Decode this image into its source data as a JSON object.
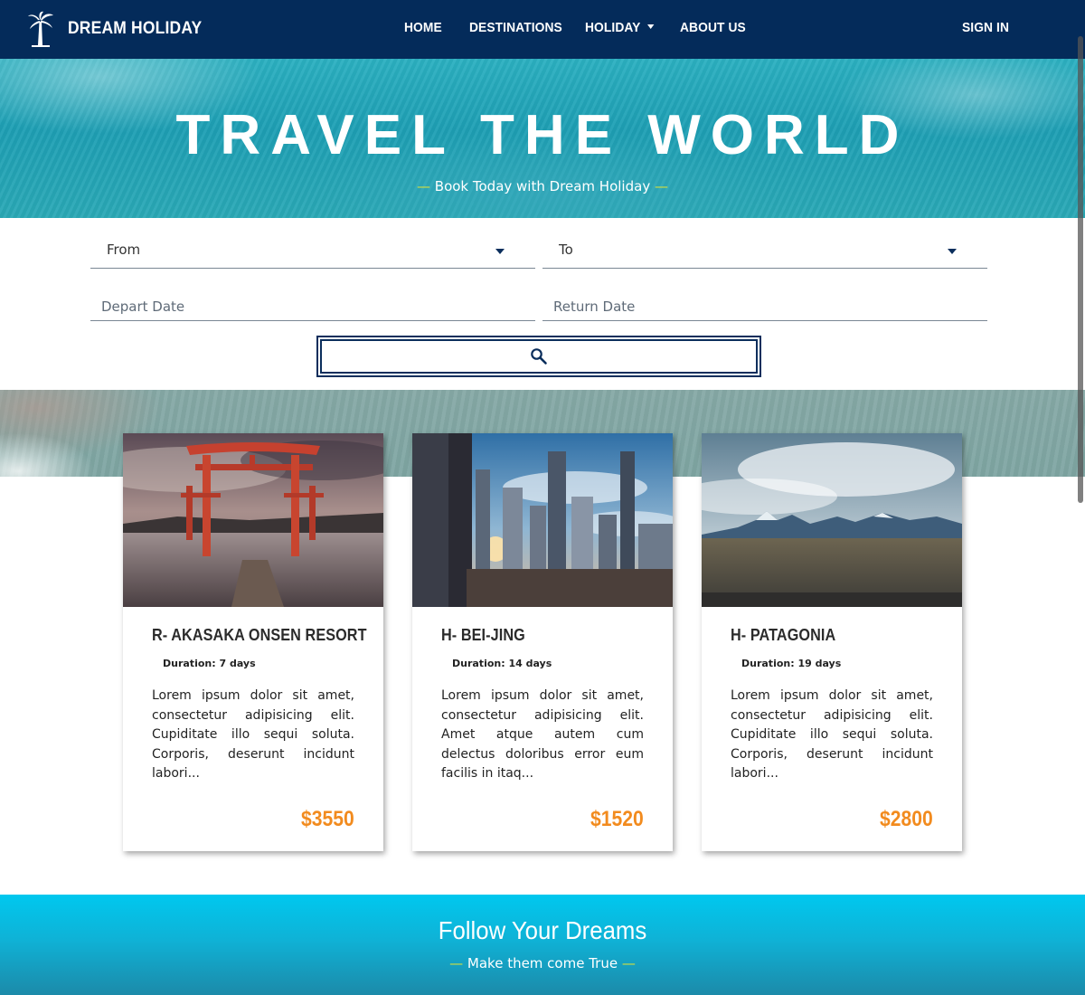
{
  "navbar": {
    "brand": "DREAM HOLIDAY",
    "links": [
      "HOME",
      "DESTINATIONS",
      "HOLIDAY",
      "ABOUT US"
    ],
    "sign_in": "SIGN IN",
    "background": "#042b5a"
  },
  "hero": {
    "title": "TRAVEL THE WORLD",
    "subtitle_dash_left": "—",
    "subtitle": "Book Today with Dream Holiday",
    "subtitle_dash_right": "—"
  },
  "search": {
    "from_label": "From",
    "to_label": "To",
    "depart_placeholder": "Depart Date",
    "return_placeholder": "Return Date",
    "button_icon": "search-icon"
  },
  "cards": [
    {
      "title": "R- AKASAKA ONSEN RESORT",
      "duration": "Duration: 7 days",
      "description": "Lorem ipsum dolor sit amet, consectetur adipisicing elit. Cupiditate illo sequi soluta. Corporis, deserunt incidunt labori...",
      "price": "$3550"
    },
    {
      "title": "H- BEI-JING",
      "duration": "Duration: 14 days",
      "description": "Lorem ipsum dolor sit amet, consectetur adipisicing elit. Amet atque autem cum delectus doloribus error eum facilis in itaq...",
      "price": "$1520"
    },
    {
      "title": "H- PATAGONIA",
      "duration": "Duration: 19 days",
      "description": "Lorem ipsum dolor sit amet, consectetur adipisicing elit. Cupiditate illo sequi soluta. Corporis, deserunt incidunt labori...",
      "price": "$2800"
    }
  ],
  "footer": {
    "title": "Follow Your Dreams",
    "dash_left": "—",
    "subtitle": "Make them come True",
    "dash_right": "—"
  },
  "colors": {
    "accent_price": "#f28b1e",
    "dash": "#d8e03a",
    "navy": "#0b2e5c"
  }
}
